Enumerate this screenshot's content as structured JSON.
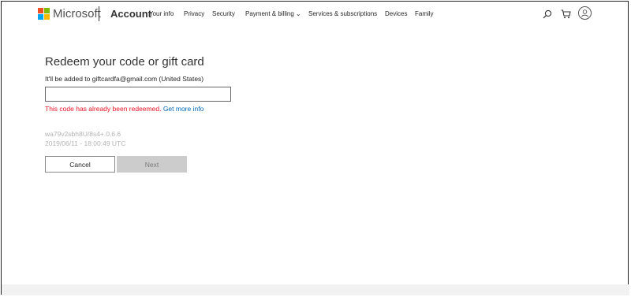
{
  "header": {
    "brand": "Microsoft",
    "account": "Account",
    "nav": [
      "Your info",
      "Privacy",
      "Security",
      "Payment & billing",
      "Services & subscriptions",
      "Devices",
      "Family"
    ],
    "logo_colors": [
      "#f25022",
      "#7fba00",
      "#00a4ef",
      "#ffb900"
    ]
  },
  "main": {
    "title": "Redeem your code or gift card",
    "subtitle": "It'll be added to giftcardfa@gmail.com (United States)",
    "code_value": "",
    "error": "This code has already been redeemed.",
    "error_link": "Get more info",
    "meta_line1": "wa79v2sbh8U/8s4+.0.6.6",
    "meta_line2": "2019/06/11 - 18:00:49 UTC",
    "cancel": "Cancel",
    "next": "Next"
  },
  "colors": {
    "error": "#e81123",
    "link": "#0067b8",
    "disabled_button": "#cccccc"
  },
  "icons": [
    "search-icon",
    "cart-icon",
    "user-icon",
    "chevron-down-icon"
  ]
}
